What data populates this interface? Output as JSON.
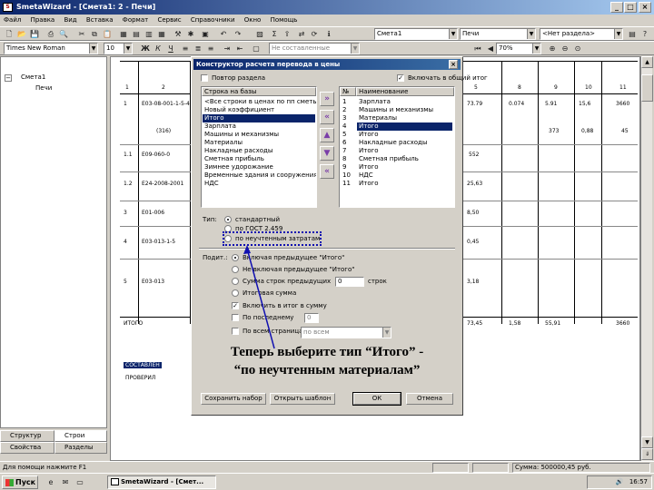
{
  "window": {
    "title": "SmetaWizard - [Смета1: 2 - Печи]",
    "controls": [
      "_",
      "□",
      "×"
    ]
  },
  "menu": [
    "Файл",
    "Правка",
    "Вид",
    "Вставка",
    "Формат",
    "Сервис",
    "Справочники",
    "Окно",
    "Помощь"
  ],
  "toolbar": {
    "combo_smeta": "Смета1",
    "combo_section": "Печи",
    "combo_razdel": "<Нет разделa>",
    "font_name": "Times New Roman",
    "font_size": "10",
    "combo_sostav": "Не составленные",
    "zoom": "70%"
  },
  "tree": {
    "root": "Смета1",
    "child": "Печи"
  },
  "tabs": {
    "structure": "Структур",
    "build": "Строи",
    "properties": "Свойства",
    "sections": "Разделы"
  },
  "doc": {
    "cols": [
      "1",
      "2",
      "5",
      "8",
      "9",
      "10",
      "11"
    ],
    "rows": [
      {
        "n": "1",
        "code": "Е03-08-001-1-5-4",
        "a": "73.79",
        "b": "0.074",
        "c": "5.91",
        "d": "15,6",
        "e": "3660"
      },
      {
        "n": "",
        "code": "(316)",
        "a": "",
        "b": "",
        "c": "373",
        "d": "0,88",
        "e": "45"
      },
      {
        "n": "1.1",
        "code": "Е09-060-0",
        "a": "552",
        "b": "",
        "c": "",
        "d": "",
        "e": ""
      },
      {
        "n": "1.2",
        "code": "Е24-2008-2001",
        "a": "25,63",
        "b": "",
        "c": "",
        "d": "",
        "e": ""
      },
      {
        "n": "3",
        "code": "Е01-006",
        "a": "8,50",
        "b": "",
        "c": "",
        "d": "",
        "e": ""
      },
      {
        "n": "4",
        "code": "Е03-013-1-5",
        "a": "0,45",
        "b": "",
        "c": "",
        "d": "",
        "e": ""
      },
      {
        "n": "5",
        "code": "Е03-013",
        "a": "3,18",
        "b": "",
        "c": "",
        "d": "",
        "e": ""
      }
    ],
    "total_label": "ИТОГО",
    "total_values": [
      "73,45",
      "1,58",
      "55,91",
      "3660"
    ],
    "footer_left": [
      "СОСТАВЛЕН",
      "ПРОВЕРИЛ"
    ]
  },
  "dialog": {
    "title": "Конструктор расчета перевода в цены",
    "repeat_section": "Повтор раздела",
    "include_total": "Включать в общий итог",
    "left_header": "Строка на базы",
    "left_items": [
      "<Все строки в ценах по пп сметы>",
      "Новый коэффициент",
      "Итого",
      "Зарплата",
      "Машины и механизмы",
      "Материалы",
      "Накладные расходы",
      "Сметная прибыль",
      "Зимнее удорожание",
      "Временные здания и сооружения",
      "НДС"
    ],
    "left_selected": 2,
    "right_header_n": "№",
    "right_header_name": "Наименование",
    "right_items": [
      {
        "n": "1",
        "name": "Зарплата"
      },
      {
        "n": "2",
        "name": "Машины и механизмы"
      },
      {
        "n": "3",
        "name": "Материалы"
      },
      {
        "n": "4",
        "name": "Итого"
      },
      {
        "n": "5",
        "name": "Итого"
      },
      {
        "n": "6",
        "name": "Накладные расходы"
      },
      {
        "n": "7",
        "name": "Итого"
      },
      {
        "n": "8",
        "name": "Сметная прибыль"
      },
      {
        "n": "9",
        "name": "Итого"
      },
      {
        "n": "10",
        "name": "НДС"
      },
      {
        "n": "11",
        "name": "Итого"
      }
    ],
    "right_selected": 3,
    "type_label": "Тип:",
    "type_options": [
      "стандартный",
      "по ГОСТ 2.459",
      "по неучтенным затратам"
    ],
    "type_selected": 0,
    "total_label": "Подит.:",
    "total_options": [
      "Включая предыдущее \"Итого\"",
      "Не включая предыдущее \"Итого\"",
      "Сумма строк предыдущих",
      "Итоговая сумма"
    ],
    "total_selected": 0,
    "rows_count": "0",
    "rows_unit": "строк",
    "in_total_check": "Включить в итог в сумму",
    "on_last_page": "По последнему",
    "in_all_pages": "По всем страницам",
    "page_num": "0",
    "combo_all": "по всем",
    "btn_save": "Сохранить набор",
    "btn_open": "Открыть шаблон",
    "btn_ok": "ОК",
    "btn_cancel": "Отмена"
  },
  "annotation": {
    "line1": "Теперь выберите тип “Итого” -",
    "line2": "“по неучтенным материалам”",
    "color": "#1010b0"
  },
  "status": {
    "left": "Для помощи нажмите F1",
    "right": "Сумма: 500000,45 руб."
  },
  "taskbar": {
    "start": "Пуск",
    "app": "SmetaWizard - [Смет...",
    "clock": "16:57"
  }
}
